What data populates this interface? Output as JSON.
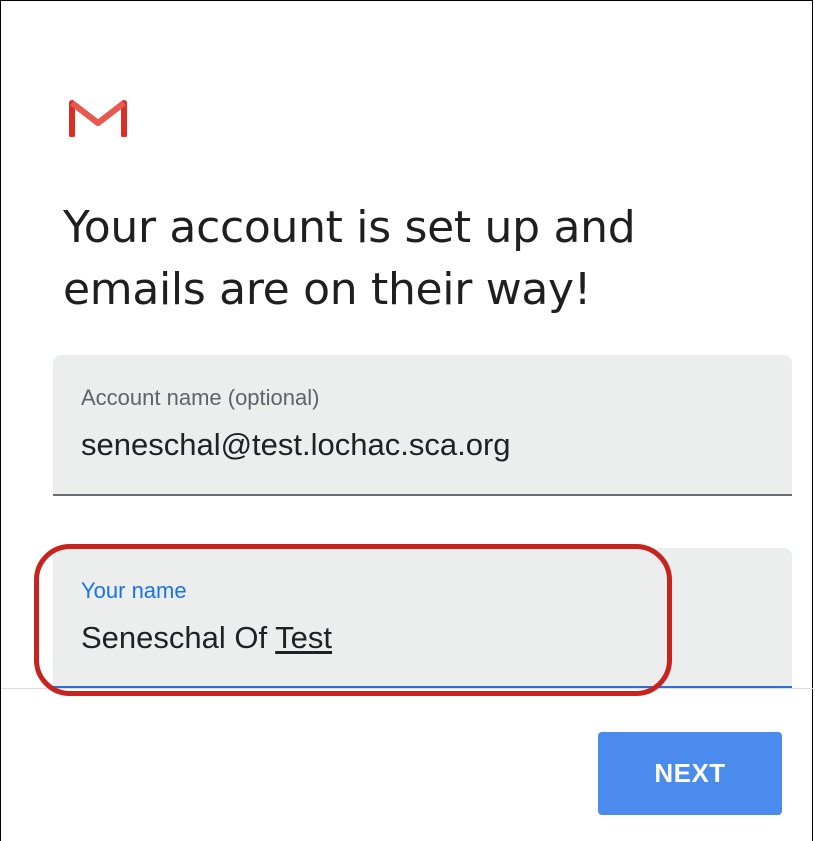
{
  "app": {
    "logo_icon": "gmail-m-icon",
    "brand_color": "#d93025"
  },
  "headline": "Your account is set up and emails are on their way!",
  "account_field": {
    "label": "Account name (optional)",
    "value": "seneschal@test.lochac.sca.org"
  },
  "name_field": {
    "label": "Your name",
    "value_prefix": "Seneschal Of ",
    "value_underlined": "Test",
    "focused": true,
    "accent_color": "#1a73e8"
  },
  "annotation": {
    "type": "highlight-outline",
    "color": "#c8241f"
  },
  "actions": {
    "next_label": "NEXT",
    "next_color": "#4a8bed"
  }
}
